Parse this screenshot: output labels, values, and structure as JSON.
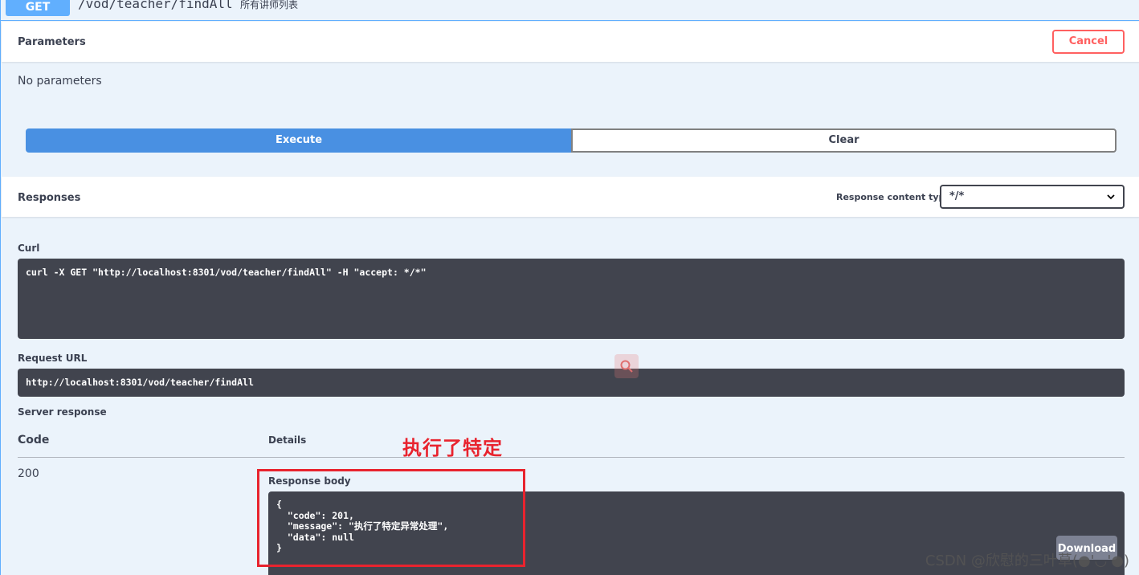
{
  "operation": {
    "method": "GET",
    "path": "/vod/teacher/findAll",
    "summary": "所有讲师列表"
  },
  "parameters": {
    "title": "Parameters",
    "cancel_label": "Cancel",
    "empty_text": "No parameters"
  },
  "actions": {
    "execute_label": "Execute",
    "clear_label": "Clear"
  },
  "responses": {
    "title": "Responses",
    "content_type_label": "Response content type",
    "content_type_value": "*/*"
  },
  "curl": {
    "label": "Curl",
    "command": "curl -X GET \"http://localhost:8301/vod/teacher/findAll\" -H \"accept: */*\""
  },
  "request_url": {
    "label": "Request URL",
    "value": "http://localhost:8301/vod/teacher/findAll"
  },
  "server_response": {
    "label": "Server response",
    "code_header": "Code",
    "details_header": "Details",
    "status_code": "200",
    "body_label": "Response body",
    "body": "{\n  \"code\": 201,\n  \"message\": \"执行了特定异常处理\",\n  \"data\": null\n}",
    "download_label": "Download"
  },
  "annotation": {
    "text": "执行了特定",
    "color": "#e8232e"
  },
  "watermark": "CSDN @欣慰的三叶草(●'◡'●)",
  "colors": {
    "get_blue": "#61affe",
    "execute_blue": "#4990e2",
    "cancel_red": "#ff6060",
    "code_bg": "#41444e",
    "page_bg": "#ebf3fb"
  }
}
